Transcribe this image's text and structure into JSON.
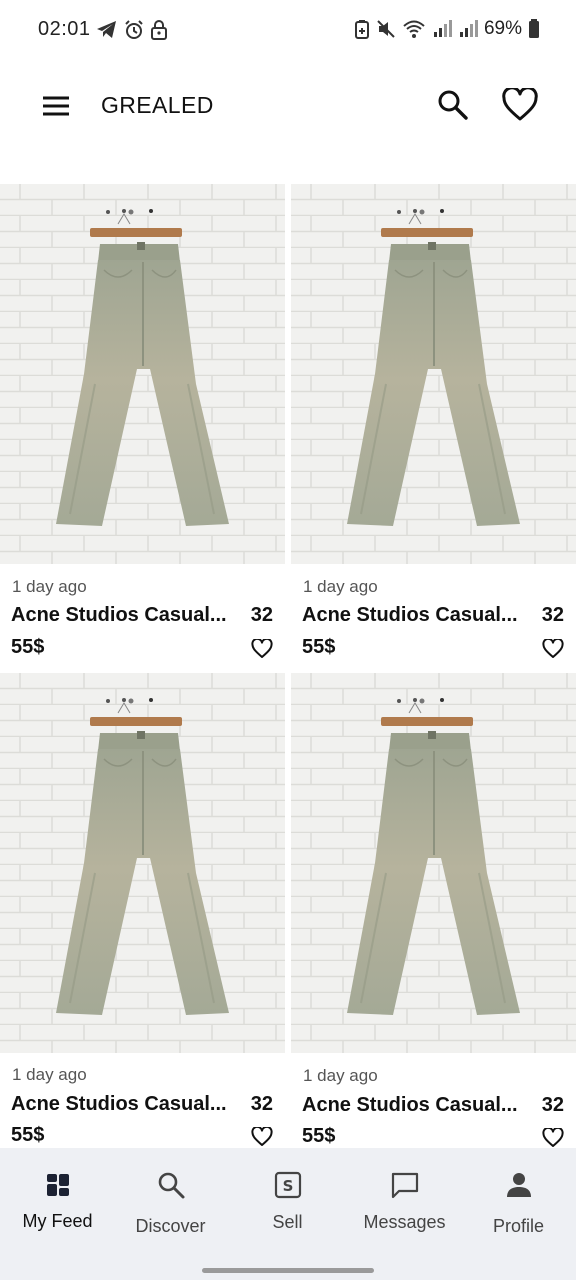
{
  "status_bar": {
    "time": "02:01",
    "battery": "69%",
    "left_icons": [
      "telegram-icon",
      "alarm-icon",
      "lock-icon"
    ],
    "right_icons": [
      "battery-saver-icon",
      "mute-icon",
      "wifi-icon",
      "signal-icon",
      "signal-icon",
      "battery-icon"
    ]
  },
  "app_bar": {
    "title": "GREALED",
    "icons": [
      "menu-icon",
      "search-icon",
      "heart-icon"
    ]
  },
  "feed": {
    "items": [
      {
        "time": "1 day ago",
        "title": "Acne Studios Casual...",
        "size": "32",
        "price": "55$"
      },
      {
        "time": "1 day ago",
        "title": "Acne Studios Casual...",
        "size": "32",
        "price": "55$"
      },
      {
        "time": "1 day ago",
        "title": "Acne Studios Casual...",
        "size": "32",
        "price": "55$"
      },
      {
        "time": "1 day ago",
        "title": "Acne Studios Casual...",
        "size": "32",
        "price": "55$"
      }
    ]
  },
  "bottom_nav": {
    "items": [
      {
        "label": "My Feed",
        "icon": "dashboard-icon",
        "active": true
      },
      {
        "label": "Discover",
        "icon": "search-icon",
        "active": false
      },
      {
        "label": "Sell",
        "icon": "sell-icon",
        "active": false
      },
      {
        "label": "Messages",
        "icon": "chat-icon",
        "active": false
      },
      {
        "label": "Profile",
        "icon": "person-icon",
        "active": false
      }
    ]
  },
  "colors": {
    "nav_background": "#eef0f4",
    "text_primary": "#111111",
    "text_secondary": "#555555",
    "jeans": "#a7ab96",
    "wall": "#eeeeec"
  }
}
